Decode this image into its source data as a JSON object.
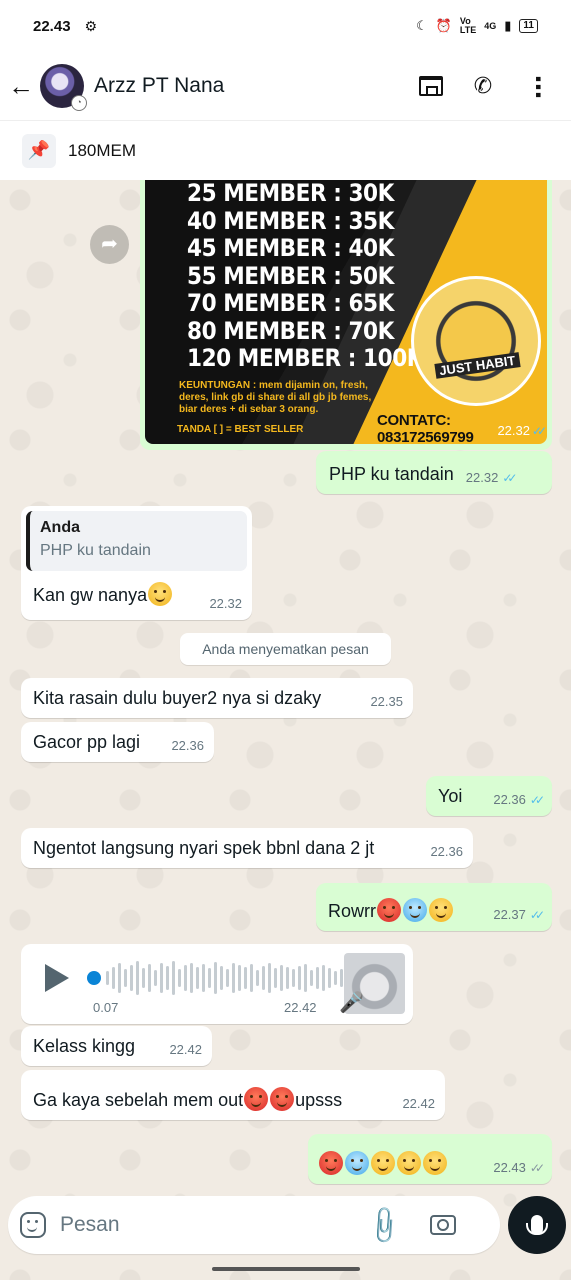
{
  "status_bar": {
    "time": "22.43",
    "network": "4G",
    "battery": "11"
  },
  "header": {
    "contact_name": "Arzz PT Nana"
  },
  "pinned": {
    "text": "180MEM"
  },
  "image_message": {
    "lines": [
      "25 MEMBER : 30K",
      "40 MEMBER : 35K",
      "45 MEMBER : 40K",
      "55 MEMBER : 50K",
      "70 MEMBER : 65K",
      "80 MEMBER : 70K",
      "120 MEMBER : 100K"
    ],
    "note": "KEUNTUNGAN : mem dijamin on, fresh, deres, link gb di share di all gb jb femes, biar deres + di sebar 3 orang.",
    "tanda": "TANDA [      ] = BEST SELLER",
    "contact": "CONTATC: 083172569799",
    "logo_text": "JUST HABIT",
    "time": "22.32"
  },
  "messages": [
    {
      "id": "m1",
      "dir": "out",
      "text": "PHP ku tandain",
      "time": "22.32",
      "read": true
    },
    {
      "id": "m3",
      "dir": "in",
      "text": "Kita rasain dulu buyer2 nya si dzaky",
      "time": "22.35"
    },
    {
      "id": "m4",
      "dir": "in",
      "text": "Gacor pp lagi",
      "time": "22.36"
    },
    {
      "id": "m5",
      "dir": "out",
      "text": "Yoi",
      "time": "22.36",
      "read": true
    },
    {
      "id": "m6",
      "dir": "in",
      "text": "Ngentot langsung nyari spek bbnl dana 2 jt",
      "time": "22.36"
    },
    {
      "id": "m7",
      "dir": "out",
      "text": "Rowrr",
      "time": "22.37",
      "read": true
    },
    {
      "id": "m9",
      "dir": "in",
      "text": "Kelass kingg",
      "time": "22.42"
    },
    {
      "id": "m10",
      "dir": "in",
      "text": "Ga kaya sebelah mem out",
      "suffix": " upsss",
      "time": "22.42"
    },
    {
      "id": "m11",
      "dir": "out",
      "text": "",
      "time": "22.43",
      "read": false
    }
  ],
  "reply_message": {
    "quote_author": "Anda",
    "quote_text": "PHP ku tandain",
    "text": "Kan gw nanya",
    "time": "22.32"
  },
  "system_notice": "Anda menyematkan pesan",
  "voice_message": {
    "duration": "0.07",
    "time": "22.42"
  },
  "composer": {
    "placeholder": "Pesan"
  },
  "colors": {
    "outgoing": "#d9fdd3",
    "incoming": "#ffffff",
    "read_tick": "#53bdeb",
    "chat_bg": "#efeae2"
  }
}
